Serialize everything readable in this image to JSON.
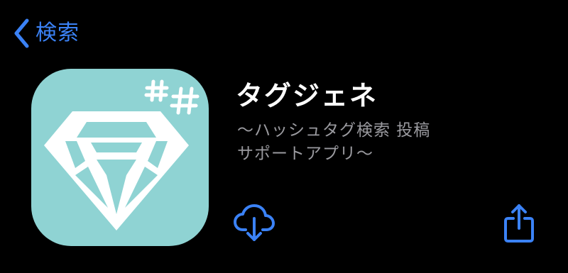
{
  "nav": {
    "back_label": "検索",
    "back_icon": "chevron-left-icon"
  },
  "app": {
    "name": "タグジェネ",
    "subtitle_line1": "〜ハッシュタグ検索 投稿",
    "subtitle_line2": "サポートアプリ〜",
    "icon": "diamond-hashtag-app-icon",
    "icon_bg_color": "#8fd3d3"
  },
  "actions": {
    "download_icon": "cloud-download-icon",
    "share_icon": "share-icon"
  },
  "colors": {
    "background": "#000000",
    "accent": "#3b82f6",
    "title": "#ffffff",
    "subtitle": "#9a9a9f"
  }
}
